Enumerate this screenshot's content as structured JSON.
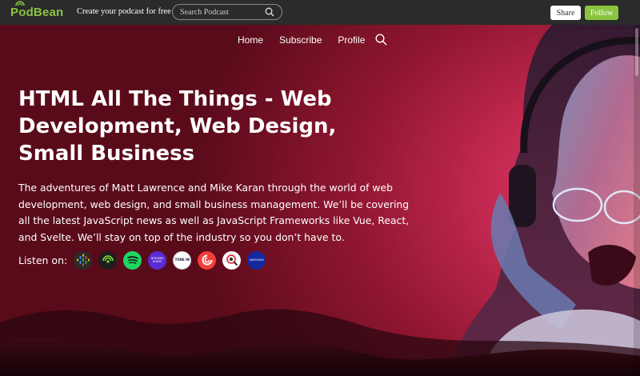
{
  "brand": {
    "name": "PodBean",
    "color": "#8ac53f"
  },
  "topbar": {
    "tagline": "Create your podcast for free",
    "search_placeholder": "Search Podcast",
    "share_label": "Share",
    "follow_label": "Follow"
  },
  "nav": {
    "items": [
      "Home",
      "Subscribe",
      "Profile"
    ]
  },
  "podcast": {
    "title": "HTML All The Things - Web Development, Web Design, Small Business",
    "description": "The adventures of Matt Lawrence and Mike Karan through the world of web development, web design, and small business management. We’ll be covering all the latest JavaScript news as well as JavaScript Frameworks like Vue, React, and Svelte. We’ll stay on top of the industry so you don’t have to."
  },
  "listen": {
    "label": "Listen on:",
    "platforms": [
      {
        "icon": "google-podcasts-icon",
        "bg": "#2b2b2b"
      },
      {
        "icon": "podcast-addict-icon",
        "bg": "#1e1e1e"
      },
      {
        "icon": "spotify-icon",
        "bg": "#1ed760"
      },
      {
        "icon": "amazon-music-icon",
        "bg": "#5b2bd3",
        "text": "amazon music"
      },
      {
        "icon": "tunein-icon",
        "bg": "#ffffff",
        "text": "TUNE IN"
      },
      {
        "icon": "pocket-casts-icon",
        "bg": "#f43e37"
      },
      {
        "icon": "podchaser-icon",
        "bg": "#ffffff"
      },
      {
        "icon": "samsung-podcasts-icon",
        "bg": "#1428a0",
        "text": "SAMSUNG"
      }
    ]
  },
  "colors": {
    "topbar": "#2b2b2b",
    "hero_primary": "#c2284f",
    "follow": "#8ac53f"
  }
}
